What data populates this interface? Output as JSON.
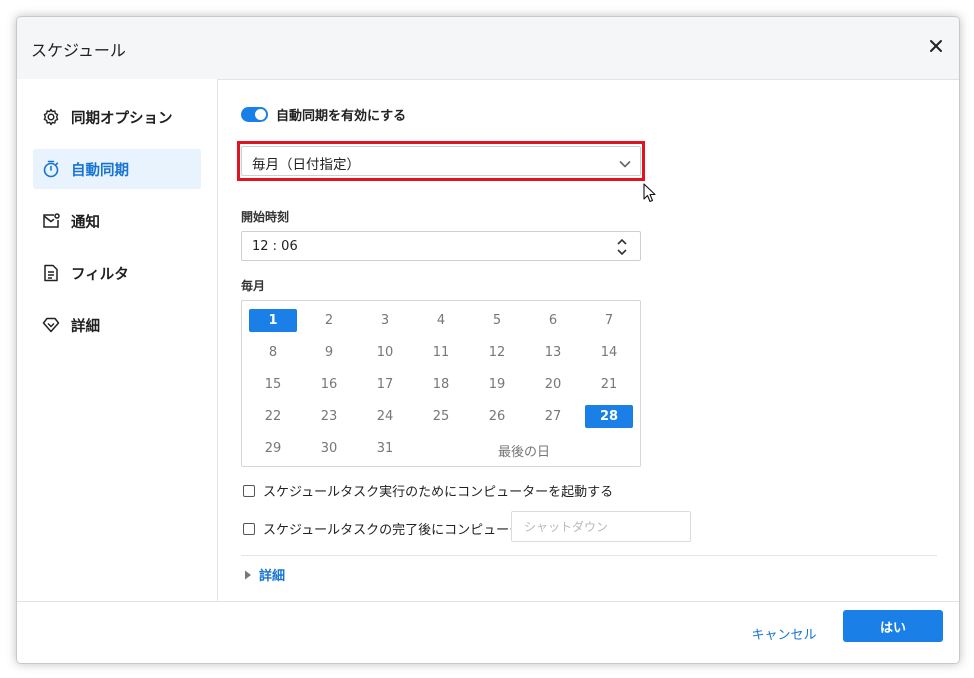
{
  "dialog": {
    "title": "スケジュール",
    "close_icon": "close-icon"
  },
  "sidebar": {
    "items": [
      {
        "label": "同期オプション",
        "icon": "gear-icon"
      },
      {
        "label": "自動同期",
        "icon": "timer-icon",
        "active": true
      },
      {
        "label": "通知",
        "icon": "mail-icon"
      },
      {
        "label": "フィルタ",
        "icon": "document-icon"
      },
      {
        "label": "詳細",
        "icon": "diamond-icon"
      }
    ]
  },
  "main": {
    "auto_sync_toggle": {
      "label": "自動同期を有効にする",
      "on": true
    },
    "schedule_type": {
      "value": "毎月（日付指定）"
    },
    "start_time": {
      "label": "開始時刻",
      "value": "12 : 06"
    },
    "monthly": {
      "label": "毎月",
      "days": [
        "1",
        "2",
        "3",
        "4",
        "5",
        "6",
        "7",
        "8",
        "9",
        "10",
        "11",
        "12",
        "13",
        "14",
        "15",
        "16",
        "17",
        "18",
        "19",
        "20",
        "21",
        "22",
        "23",
        "24",
        "25",
        "26",
        "27",
        "28",
        "29",
        "30",
        "31"
      ],
      "selected": [
        "1",
        "28"
      ],
      "last_day_label": "最後の日"
    },
    "wake_computer": {
      "label": "スケジュールタスク実行のためにコンピューターを起動する",
      "checked": false
    },
    "after_task": {
      "label": "スケジュールタスクの完了後にコンピューターを",
      "checked": false,
      "placeholder": "シャットダウン"
    },
    "advanced": {
      "label": "詳細"
    }
  },
  "footer": {
    "cancel_label": "キャンセル",
    "ok_label": "はい"
  },
  "colors": {
    "accent": "#1a7fe6",
    "highlight_border": "#e3131e"
  }
}
